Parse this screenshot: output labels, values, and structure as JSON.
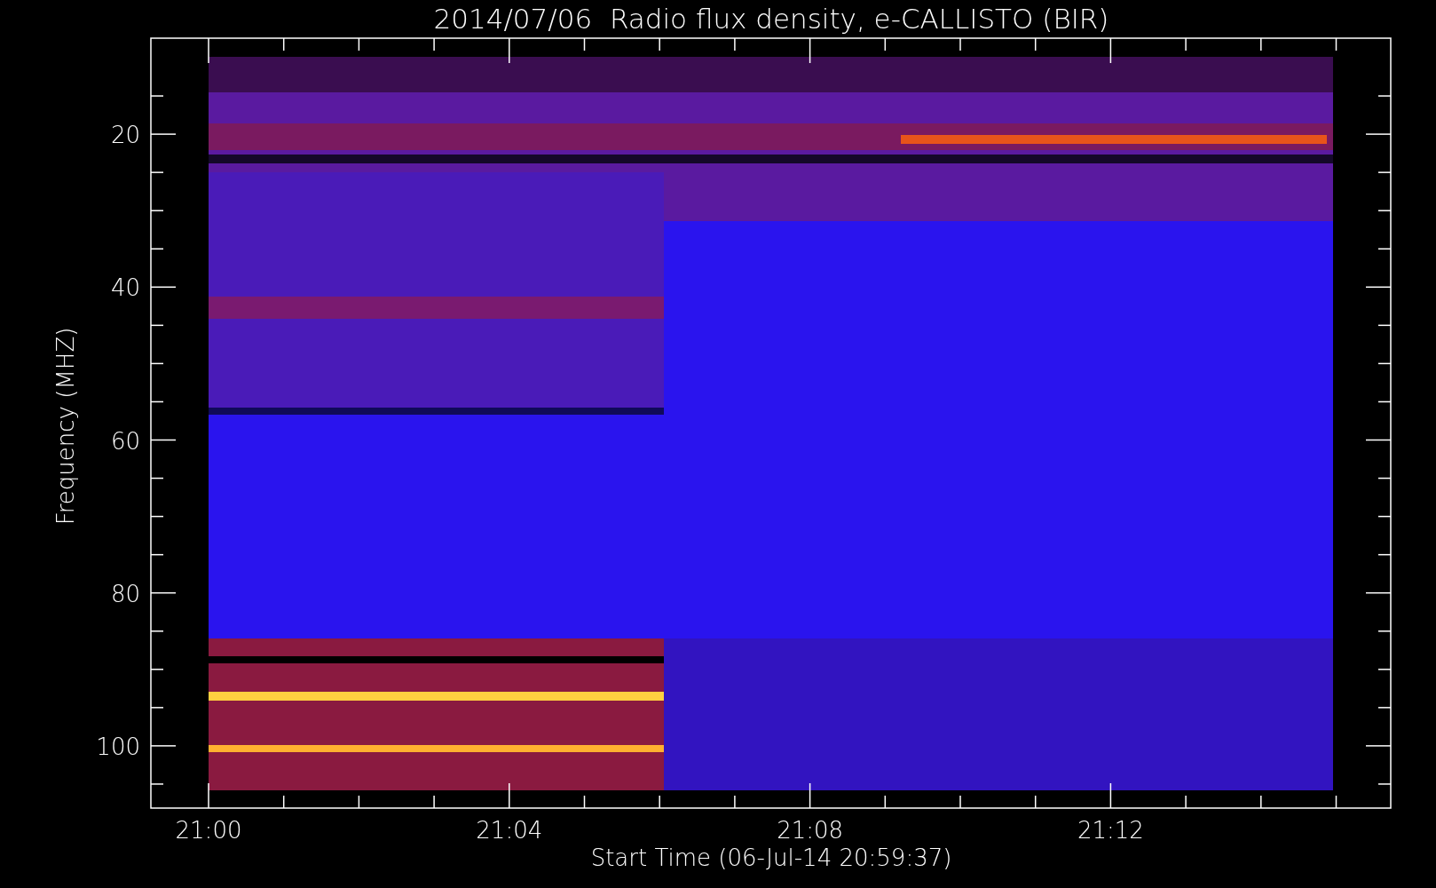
{
  "title": "2014/07/06  Radio flux density, e-CALLISTO (BIR)",
  "y_axis": {
    "label": "Frequency (MHZ)",
    "ticks": [
      "20",
      "40",
      "60",
      "80",
      "100"
    ]
  },
  "x_axis": {
    "label": "Start Time (06-Jul-14 20:59:37)",
    "ticks": [
      "21:00",
      "21:04",
      "21:08",
      "21:12"
    ]
  }
}
